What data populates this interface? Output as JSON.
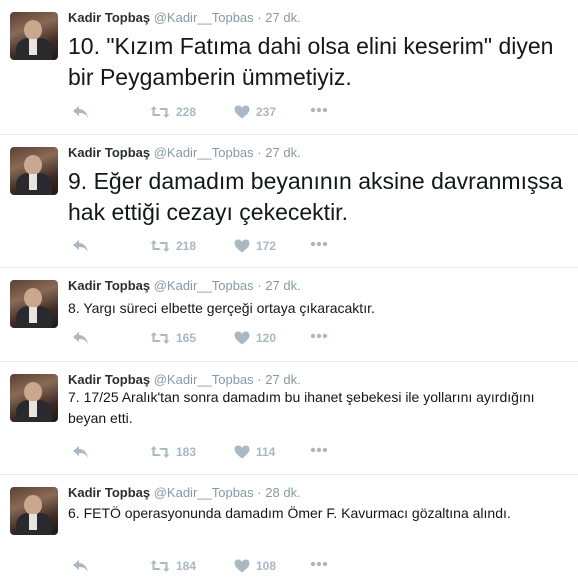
{
  "tweets": [
    {
      "name": "Kadir Topbaş",
      "handle": "@Kadir__Topbas",
      "dot": "·",
      "time": "27 dk.",
      "text": "10. \"Kızım Fatıma dahi olsa elini keserim\" diyen bir Peygamberin ümmetiyiz.",
      "retweets": "228",
      "likes": "237"
    },
    {
      "name": "Kadir Topbaş",
      "handle": "@Kadir__Topbas",
      "dot": "·",
      "time": "27 dk.",
      "text": "9. Eğer damadım beyanının aksine davranmışsa hak ettiği cezayı çekecektir.",
      "retweets": "218",
      "likes": "172"
    },
    {
      "name": "Kadir Topbaş",
      "handle": "@Kadir__Topbas",
      "dot": "·",
      "time": "27 dk.",
      "text": "8. Yargı süreci elbette gerçeği ortaya çıkaracaktır.",
      "retweets": "165",
      "likes": "120"
    },
    {
      "name": "Kadir Topbaş",
      "handle": "@Kadir__Topbas",
      "dot": "·",
      "time": "27 dk.",
      "text": "7. 17/25 Aralık'tan sonra damadım bu ihanet şebekesi ile yollarını ayırdığını beyan etti.",
      "retweets": "183",
      "likes": "114"
    },
    {
      "name": "Kadir Topbaş",
      "handle": "@Kadir__Topbas",
      "dot": "·",
      "time": "28 dk.",
      "text": "6. FETÖ operasyonunda damadım Ömer F. Kavurmacı gözaltına alındı.",
      "retweets": "184",
      "likes": "108"
    }
  ],
  "icons": {
    "reply": "reply-icon",
    "retweet": "retweet-icon",
    "like": "heart-icon",
    "more": "more-icon"
  },
  "colors": {
    "icon": "#aab8c2",
    "name": "#292f33",
    "meta": "#8899a6",
    "divider": "#e6ecf0"
  }
}
